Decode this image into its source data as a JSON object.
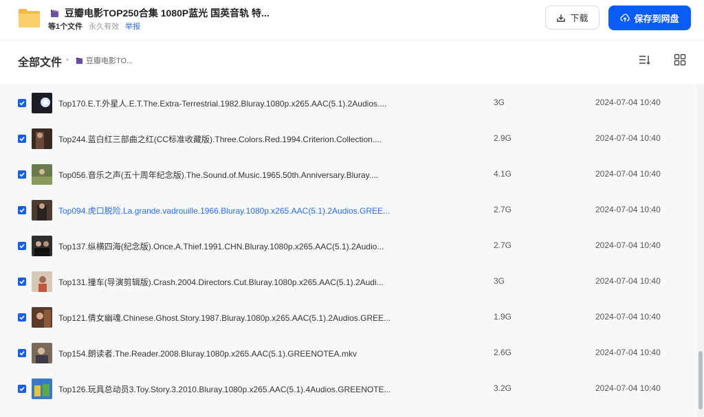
{
  "header": {
    "title": "豆瓣电影TOP250合集 1080P蓝光 国英音轨 特...",
    "file_count": "等1个文件",
    "validity": "永久有效",
    "report": "举报",
    "download_label": "下载",
    "save_label": "保存到网盘"
  },
  "breadcrumb": {
    "root": "全部文件",
    "separator": "•",
    "current": "豆瓣电影TO..."
  },
  "files": [
    {
      "name": "Top170.E.T.外星人.E.T.The.Extra-Terrestrial.1982.Bluray.1080p.x265.AAC(5.1).2Audios....",
      "size": "3G",
      "date": "2024-07-04 10:40"
    },
    {
      "name": "Top244.蓝白红三部曲之红(CC标准收藏版).Three.Colors.Red.1994.Criterion.Collection....",
      "size": "2.9G",
      "date": "2024-07-04 10:40"
    },
    {
      "name": "Top056.音乐之声(五十周年纪念版).The.Sound.of.Music.1965.50th.Anniversary.Bluray....",
      "size": "4.1G",
      "date": "2024-07-04 10:40"
    },
    {
      "name": "Top094.虎口脱险.La.grande.vadrouille.1966.Bluray.1080p.x265.AAC(5.1).2Audios.GREE...",
      "size": "2.7G",
      "date": "2024-07-04 10:40"
    },
    {
      "name": "Top137.纵横四海(纪念版).Once.A.Thief.1991.CHN.Bluray.1080p.x265.AAC(5.1).2Audio...",
      "size": "2.7G",
      "date": "2024-07-04 10:40"
    },
    {
      "name": "Top131.撞车(导演剪辑版).Crash.2004.Directors.Cut.Bluray.1080p.x265.AAC(5.1).2Audi...",
      "size": "3G",
      "date": "2024-07-04 10:40"
    },
    {
      "name": "Top121.倩女幽魂.Chinese.Ghost.Story.1987.Bluray.1080p.x265.AAC(5.1).2Audios.GREE...",
      "size": "1.9G",
      "date": "2024-07-04 10:40"
    },
    {
      "name": "Top154.朗读者.The.Reader.2008.Bluray.1080p.x265.AAC(5.1).GREENOTEA.mkv",
      "size": "2.6G",
      "date": "2024-07-04 10:40"
    },
    {
      "name": "Top126.玩具总动员3.Toy.Story.3.2010.Bluray.1080p.x265.AAC(5.1).4Audios.GREENOTE...",
      "size": "3.2G",
      "date": "2024-07-04 10:40"
    }
  ],
  "icons": {
    "folder": "folder-icon",
    "clapper": "clapperboard-icon",
    "download": "download-icon",
    "save": "cloud-upload-icon",
    "sort": "sort-icon",
    "grid": "grid-view-icon",
    "checkbox": "checkbox-checked-icon"
  },
  "colors": {
    "primary": "#0a5cf5",
    "link": "#2b6de6",
    "folder": "#f9c861",
    "list_bg": "#f7f8fa"
  }
}
